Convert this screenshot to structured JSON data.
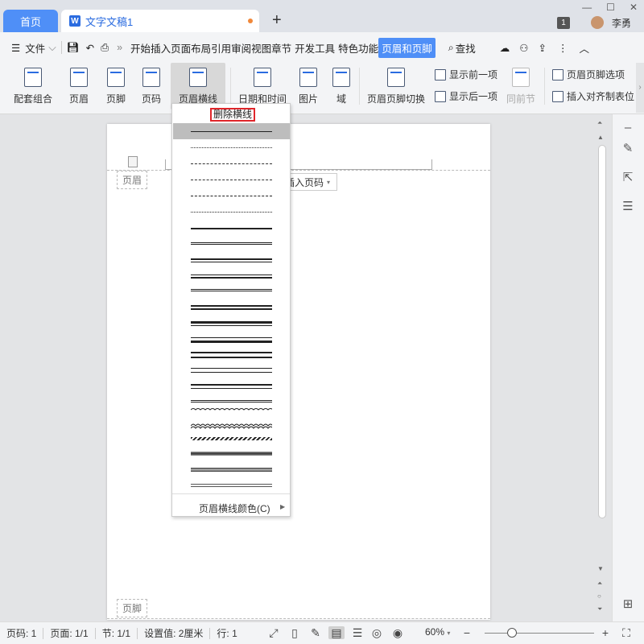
{
  "tabs": {
    "home": "首页",
    "doc": "文字文稿1",
    "doc_icon": "W",
    "new_tab": "+"
  },
  "titlebar": {
    "badge": "1",
    "user": "李勇"
  },
  "menubar": {
    "file": "文件",
    "items": [
      "开始",
      "插入",
      "页面布局",
      "引用",
      "审阅",
      "视图",
      "章节",
      "开发工具",
      "特色功能",
      "页眉和页脚"
    ],
    "search": "查找"
  },
  "ribbon": {
    "combo": "配套组合",
    "header": "页眉",
    "footer": "页脚",
    "pageno": "页码",
    "header_line": "页眉横线",
    "datetime": "日期和时间",
    "image": "图片",
    "field": "域",
    "switch": "页眉页脚切换",
    "show_prev": "显示前一项",
    "show_next": "显示后一项",
    "same_section": "同前节",
    "hf_options": "页眉页脚选项",
    "insert_align": "插入对齐制表位"
  },
  "document": {
    "header_label": "页眉",
    "footer_label": "页脚",
    "insert_pageno": "插入页码"
  },
  "dropdown": {
    "delete_line": "删除横线",
    "line_color": "页眉横线颜色(C)"
  },
  "statusbar": {
    "page_no": "页码: 1",
    "pages": "页面: 1/1",
    "section": "节: 1/1",
    "setting": "设置值: 2厘米",
    "row": "行: 1",
    "zoom": "60%"
  }
}
